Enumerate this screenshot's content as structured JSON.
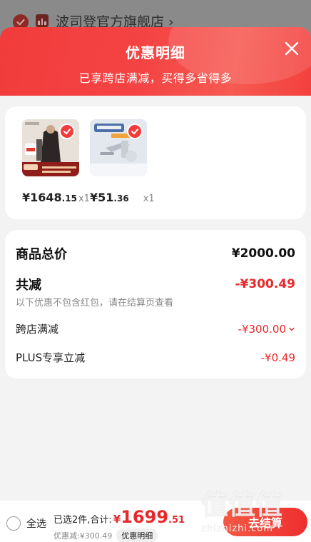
{
  "store": {
    "name": "波司登官方旗舰店 ›"
  },
  "sheet": {
    "title": "优惠明细",
    "subtitle": "已享跨店满减，买得多省得多"
  },
  "products": [
    {
      "price_int": "¥1648",
      "price_dec": ".15",
      "qty": "x1",
      "icon": "coat-product-image"
    },
    {
      "price_int": "¥51",
      "price_dec": ".36",
      "qty": "x1",
      "icon": "faucet-product-image"
    }
  ],
  "details": {
    "total_label": "商品总价",
    "total_value": "¥2000.00",
    "reduce_label": "共减",
    "reduce_value": "-¥300.49",
    "note": "以下优惠不包含红包，请在结算页查看",
    "items": [
      {
        "label": "跨店满减",
        "value": "-¥300.00",
        "has_chevron": true
      },
      {
        "label": "PLUS专享立减",
        "value": "-¥0.49",
        "has_chevron": false
      }
    ]
  },
  "bottom": {
    "select_all": "全选",
    "summary_label": "已选2件,合计:",
    "yen": "¥",
    "total_int": "1699",
    "total_dec": ".51",
    "discount": "优惠减:¥300.49",
    "detail_chip": "优惠明细",
    "checkout": "去结算"
  },
  "watermark": {
    "logo": "值值值",
    "url": "zhizhizhi.com"
  },
  "colors": {
    "accent": "#f23c3c",
    "price_red": "#e8282a"
  }
}
